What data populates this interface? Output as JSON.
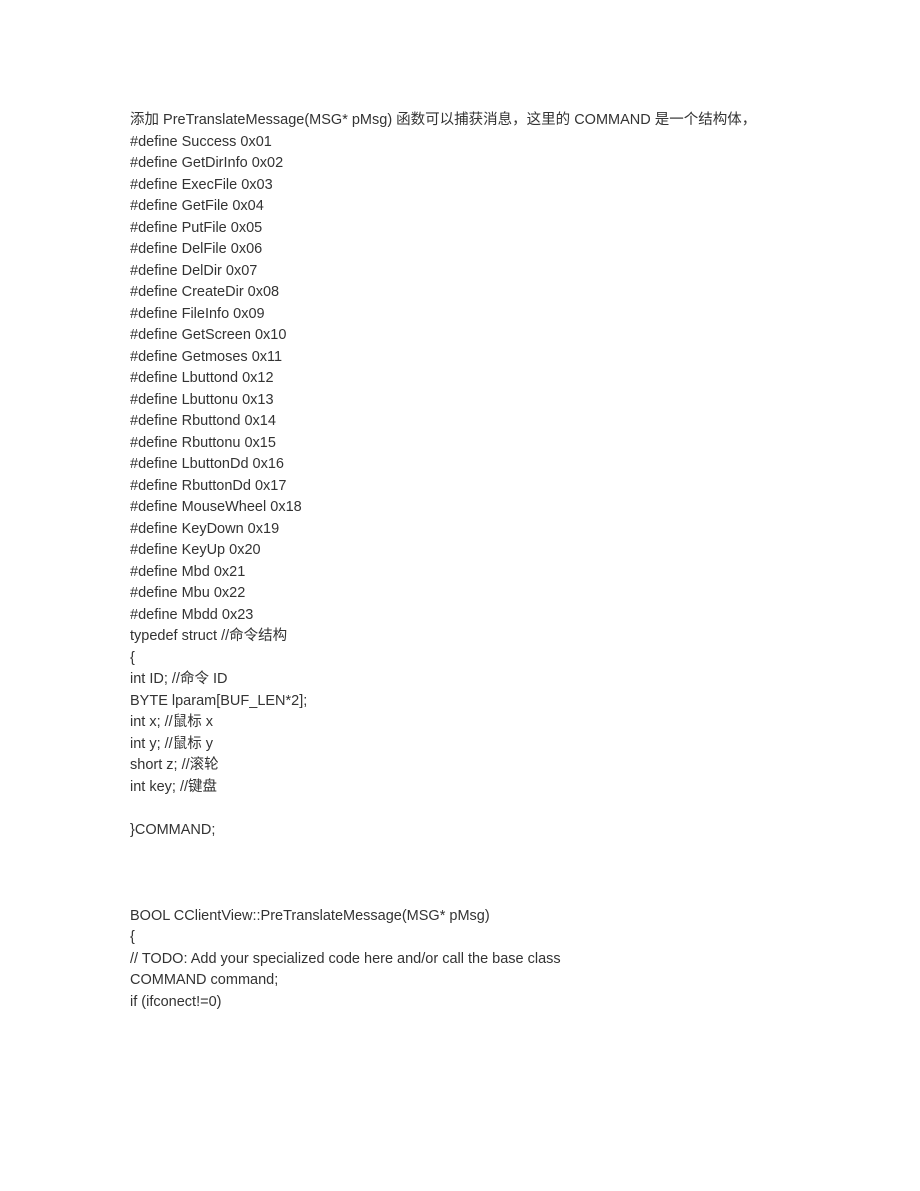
{
  "lines": [
    "添加 PreTranslateMessage(MSG* pMsg) 函数可以捕获消息，这里的 COMMAND 是一个结构体，",
    "#define Success 0x01",
    "#define GetDirInfo 0x02",
    "#define ExecFile 0x03",
    "#define GetFile 0x04",
    "#define PutFile 0x05",
    "#define DelFile 0x06",
    "#define DelDir 0x07",
    "#define CreateDir 0x08",
    "#define FileInfo 0x09",
    "#define GetScreen 0x10",
    "#define Getmoses 0x11",
    "#define Lbuttond 0x12",
    "#define Lbuttonu 0x13",
    "#define Rbuttond 0x14",
    "#define Rbuttonu 0x15",
    "#define LbuttonDd 0x16",
    "#define RbuttonDd 0x17",
    "#define MouseWheel 0x18",
    "#define KeyDown 0x19",
    "#define KeyUp 0x20",
    "#define Mbd 0x21",
    "#define Mbu 0x22",
    "#define Mbdd 0x23",
    "typedef struct //命令结构",
    "{",
    "int ID; //命令 ID",
    "BYTE lparam[BUF_LEN*2];",
    "int x; //鼠标 x",
    "int y; //鼠标 y",
    "short z; //滚轮",
    "int key; //键盘",
    "",
    "}COMMAND;",
    "",
    "",
    "",
    "BOOL CClientView::PreTranslateMessage(MSG* pMsg)",
    "{",
    "// TODO: Add your specialized code here and/or call the base class",
    "COMMAND command;",
    "if (ifconect!=0)"
  ]
}
